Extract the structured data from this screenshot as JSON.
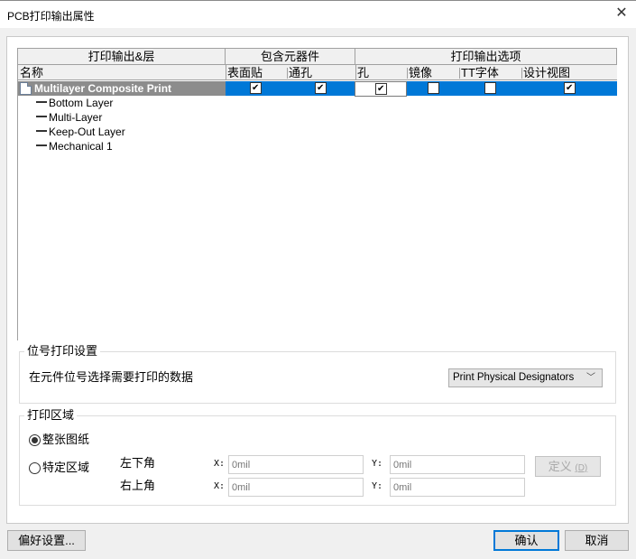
{
  "window": {
    "title": "PCB打印输出属性",
    "close_icon": "close-icon"
  },
  "grid": {
    "header_groups": [
      {
        "label": "打印输出&层"
      },
      {
        "label": "包含元器件"
      },
      {
        "label": "打印输出选项"
      }
    ],
    "columns": [
      {
        "key": "name",
        "label": "名称"
      },
      {
        "key": "smd",
        "label": "表面贴"
      },
      {
        "key": "through_hole",
        "label": "通孔"
      },
      {
        "key": "holes",
        "label": "孔"
      },
      {
        "key": "mirror",
        "label": "镜像"
      },
      {
        "key": "tt_font",
        "label": "TT字体"
      },
      {
        "key": "design_view",
        "label": "设计视图"
      }
    ],
    "printout": {
      "name": "Multilayer Composite Print",
      "icon": "document-icon",
      "smd": true,
      "through_hole": true,
      "holes": true,
      "mirror": false,
      "tt_font": false,
      "design_view": true
    },
    "layers": [
      {
        "name": "Bottom Layer"
      },
      {
        "name": "Multi-Layer"
      },
      {
        "name": "Keep-Out Layer"
      },
      {
        "name": "Mechanical 1"
      }
    ]
  },
  "designator": {
    "legend": "位号打印设置",
    "label": "在元件位号选择需要打印的数据",
    "select_value": "Print Physical Designators"
  },
  "area": {
    "legend": "打印区域",
    "options": [
      {
        "label": "整张图纸",
        "selected": true
      },
      {
        "label": "特定区域",
        "selected": false
      }
    ],
    "lower_left": {
      "label": "左下角",
      "x_label": "X:",
      "x_placeholder": "0mil",
      "y_label": "Y:",
      "y_placeholder": "0mil"
    },
    "upper_right": {
      "label": "右上角",
      "x_label": "X:",
      "x_placeholder": "0mil",
      "y_label": "Y:",
      "y_placeholder": "0mil"
    },
    "define_button": {
      "label": "定义",
      "accelerator": "(D)"
    }
  },
  "footer": {
    "preferences_label": "偏好设置...",
    "ok_label": "确认",
    "cancel_label": "取消"
  }
}
